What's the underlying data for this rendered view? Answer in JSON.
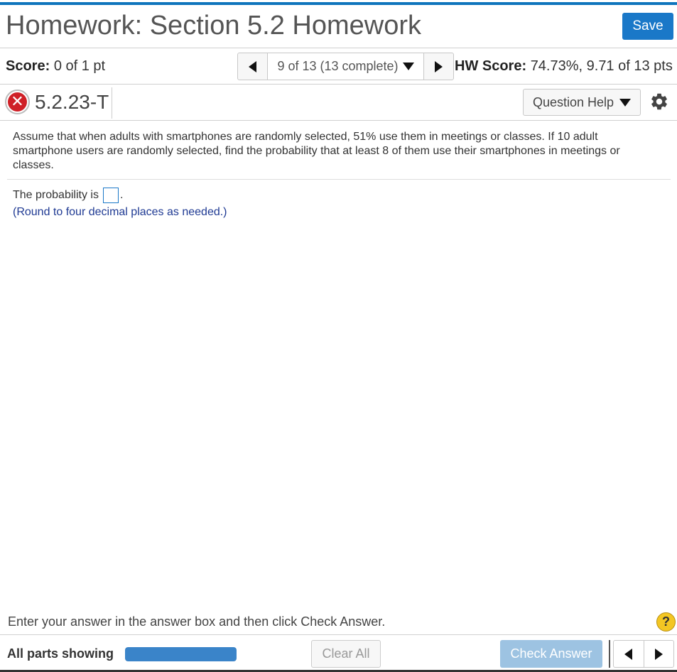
{
  "header": {
    "title": "Homework: Section 5.2 Homework",
    "save_label": "Save"
  },
  "score_row": {
    "score_label": "Score:",
    "score_value": "0 of 1 pt",
    "nav_position": "9 of 13 (13 complete)",
    "hw_score_label": "HW Score:",
    "hw_score_value": "74.73%, 9.71 of 13 pts"
  },
  "question": {
    "id": "5.2.23-T",
    "status_icon": "incorrect-x-icon",
    "help_label": "Question Help",
    "problem_text": "Assume that when adults with smartphones are randomly selected, 51% use them in meetings or classes. If 10 adult smartphone users are randomly selected, find the probability that at least 8 of them use their smartphones in meetings or classes.",
    "answer_prefix": "The probability is",
    "answer_suffix": ".",
    "answer_value": "",
    "round_note": "(Round to four decimal places as needed.)"
  },
  "footer": {
    "instruction": "Enter your answer in the answer box and then click Check Answer.",
    "help_symbol": "?",
    "all_parts_label": "All parts showing",
    "progress_fraction": 1.0,
    "clear_all_label": "Clear All",
    "check_answer_label": "Check Answer"
  },
  "colors": {
    "accent": "#0f75bc",
    "save_button": "#1a78c8",
    "incorrect": "#cf2027",
    "note_text": "#1f3a93",
    "check_answer_disabled": "#9dc3e2",
    "help_yellow": "#f3c623"
  }
}
